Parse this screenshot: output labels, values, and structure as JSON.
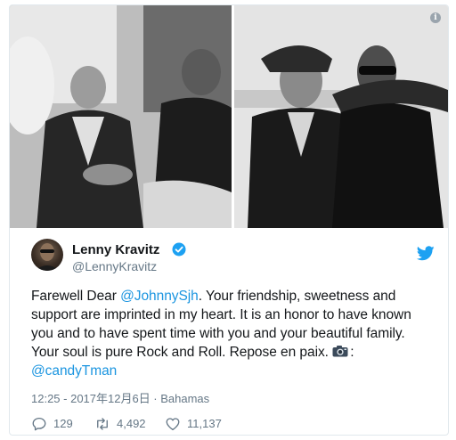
{
  "tweet": {
    "display_name": "Lenny Kravitz",
    "handle": "@LennyKravitz",
    "verified_icon": "verified-badge-icon",
    "brand_icon": "twitter-bird-icon",
    "text": {
      "line1_prefix": "Farewell Dear ",
      "line1_mention": "@JohnnySjh",
      "line1_suffix": ". Your friendship, sweetness and",
      "line2": "support are imprinted in my heart. It is an honor to have known",
      "line3": "you and to have spent time with you and your beautiful family.",
      "line4": "Your soul is pure Rock and Roll. Repose en paix.",
      "line4_suffix": ":",
      "line5_mention": "@candyTman"
    },
    "meta": "12:25 - 2017年12月6日 · Bahamas",
    "stats": {
      "replies": "129",
      "retweets": "4,492",
      "likes": "11,137"
    },
    "media_info_label": "i"
  },
  "colors": {
    "link": "#1b95e0",
    "secondary_text": "#657786",
    "primary_text": "#14171a",
    "verified": "#1da1f2",
    "border": "#e1e8ed"
  }
}
